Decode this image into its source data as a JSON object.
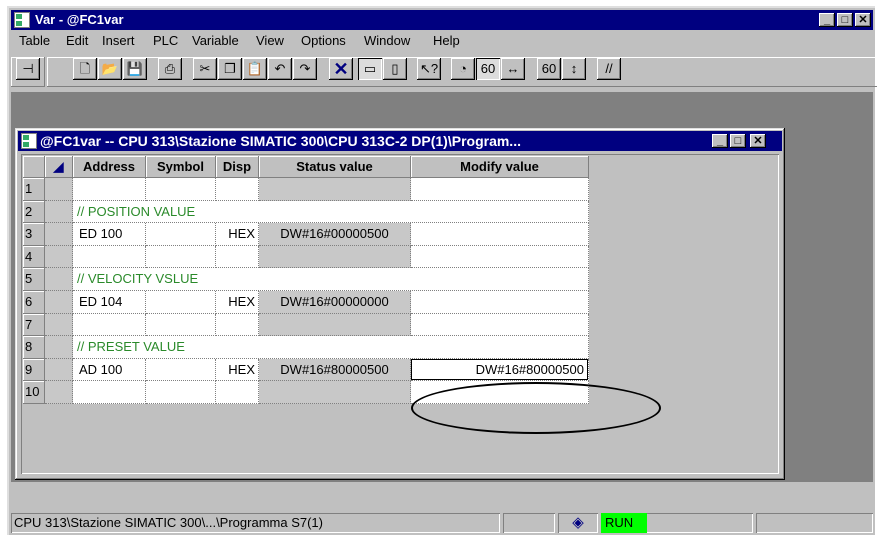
{
  "app": {
    "title": "Var - @FC1var"
  },
  "menu": [
    "Table",
    "Edit",
    "Insert",
    "PLC",
    "Variable",
    "View",
    "Options",
    "Window",
    "Help"
  ],
  "child_window": {
    "title": "@FC1var -- CPU 313\\Stazione SIMATIC 300\\CPU 313C-2 DP(1)\\Program..."
  },
  "table": {
    "headers": {
      "address": "Address",
      "symbol": "Symbol",
      "disp": "Disp",
      "status": "Status value",
      "modify": "Modify value"
    },
    "rows": [
      {
        "num": "1",
        "address": "",
        "symbol": "",
        "disp": "",
        "status": "",
        "modify": ""
      },
      {
        "num": "2",
        "comment": "//   POSITION VALUE"
      },
      {
        "num": "3",
        "address": "ED   100",
        "symbol": "",
        "disp": "HEX",
        "status": "DW#16#00000500",
        "modify": ""
      },
      {
        "num": "4",
        "address": "",
        "symbol": "",
        "disp": "",
        "status": "",
        "modify": ""
      },
      {
        "num": "5",
        "comment": "//   VELOCITY VSLUE"
      },
      {
        "num": "6",
        "address": "ED   104",
        "symbol": "",
        "disp": "HEX",
        "status": "DW#16#00000000",
        "modify": ""
      },
      {
        "num": "7",
        "address": "",
        "symbol": "",
        "disp": "",
        "status": "",
        "modify": ""
      },
      {
        "num": "8",
        "comment": "//   PRESET VALUE"
      },
      {
        "num": "9",
        "address": "AD   100",
        "symbol": "",
        "disp": "HEX",
        "status": "DW#16#80000500",
        "modify": "DW#16#80000500"
      },
      {
        "num": "10",
        "address": "",
        "symbol": "",
        "disp": "",
        "status": "",
        "modify": ""
      }
    ]
  },
  "statusbar": {
    "path": "CPU 313\\Stazione SIMATIC 300\\...\\Programma S7(1)",
    "mode": "RUN",
    "mode_color": "#00ff00"
  }
}
